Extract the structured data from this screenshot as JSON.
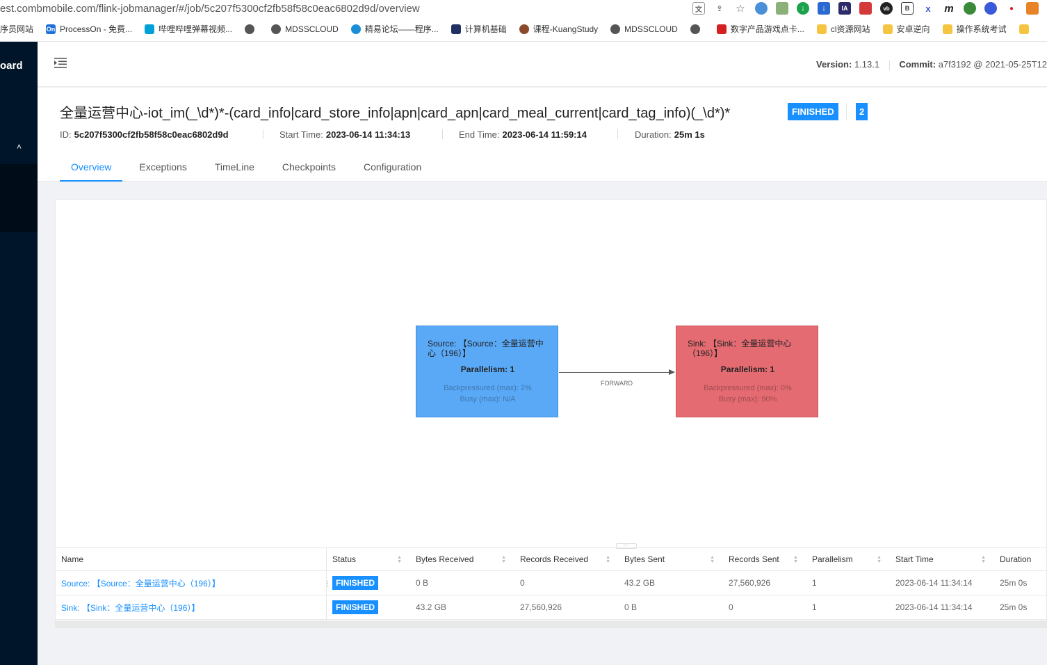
{
  "browser": {
    "url": "est.combmobile.com/flink-jobmanager/#/job/5c207f5300cf2fb58f58c0eac6802d9d/overview",
    "bookmarks": [
      {
        "label": "序员网站",
        "icon": "none",
        "color": "#ffffff"
      },
      {
        "label": "ProcessOn - 免费...",
        "icon": "processon-icon",
        "color": "#1e6fd9"
      },
      {
        "label": "哔哩哔哩弹幕视频...",
        "icon": "bilibili-icon",
        "color": "#00a1d6"
      },
      {
        "label": "",
        "icon": "globe-icon",
        "color": "#555555"
      },
      {
        "label": "MDSSCLOUD",
        "icon": "globe-icon",
        "color": "#555555"
      },
      {
        "label": "精易论坛——程序...",
        "icon": "eye-icon",
        "color": "#1a8fd6"
      },
      {
        "label": "计算机基础",
        "icon": "grid-icon",
        "color": "#203060"
      },
      {
        "label": "课程-KuangStudy",
        "icon": "avatar-icon",
        "color": "#8a4b2a"
      },
      {
        "label": "MDSSCLOUD",
        "icon": "globe-icon",
        "color": "#555555"
      },
      {
        "label": "",
        "icon": "globe-icon",
        "color": "#555555"
      },
      {
        "label": "数字产品游戏点卡...",
        "icon": "store-icon",
        "color": "#d42020"
      },
      {
        "label": "cl资源网站",
        "icon": "folder-icon",
        "color": "#f5c542"
      },
      {
        "label": "安卓逆向",
        "icon": "folder-icon",
        "color": "#f5c542"
      },
      {
        "label": "操作系统考试",
        "icon": "folder-icon",
        "color": "#f5c542"
      }
    ]
  },
  "sidebar": {
    "logo_text": "oard",
    "chevron": "˄"
  },
  "header": {
    "version_label": "Version:",
    "version_value": "1.13.1",
    "commit_label": "Commit:",
    "commit_value": "a7f3192 @ 2021-05-25T12"
  },
  "job": {
    "title": "全量运营中心-iot_im(_\\d*)*-(card_info|card_store_info|apn|card_apn|card_meal_current|card_tag_info)(_\\d*)*",
    "status": "FINISHED",
    "task_count": "2",
    "id_label": "ID:",
    "id_value": "5c207f5300cf2fb58f58c0eac6802d9d",
    "start_label": "Start Time:",
    "start_value": "2023-06-14 11:34:13",
    "end_label": "End Time:",
    "end_value": "2023-06-14 11:59:14",
    "duration_label": "Duration:",
    "duration_value": "25m 1s"
  },
  "tabs": [
    "Overview",
    "Exceptions",
    "TimeLine",
    "Checkpoints",
    "Configuration"
  ],
  "graph": {
    "source": {
      "name": "Source: 【Source：全量运营中心（196）】",
      "parallelism": "Parallelism: 1",
      "backpressured": "Backpressured (max): 2%",
      "busy": "Busy (max): N/A",
      "color": "#5aa9f7"
    },
    "sink": {
      "name": "Sink: 【Sink：全量运营中心（196）】",
      "parallelism": "Parallelism: 1",
      "backpressured": "Backpressured (max): 0%",
      "busy": "Busy (max): 90%",
      "color": "#e36b71"
    },
    "edge_label": "FORWARD"
  },
  "table": {
    "headers": [
      "Name",
      "Status",
      "Bytes Received",
      "Records Received",
      "Bytes Sent",
      "Records Sent",
      "Parallelism",
      "Start Time",
      "Duration"
    ],
    "rows": [
      {
        "name": "Source: 【Source：全量运营中心（196）】",
        "status": "FINISHED",
        "bytes_received": "0 B",
        "records_received": "0",
        "bytes_sent": "43.2 GB",
        "records_sent": "27,560,926",
        "parallelism": "1",
        "start_time": "2023-06-14 11:34:14",
        "duration": "25m 0s"
      },
      {
        "name": "Sink: 【Sink：全量运营中心（196）】",
        "status": "FINISHED",
        "bytes_received": "43.2 GB",
        "records_received": "27,560,926",
        "bytes_sent": "0 B",
        "records_sent": "0",
        "parallelism": "1",
        "start_time": "2023-06-14 11:34:14",
        "duration": "25m 0s"
      }
    ]
  },
  "colors": {
    "accent": "#1890ff",
    "sidebar": "#001529"
  }
}
